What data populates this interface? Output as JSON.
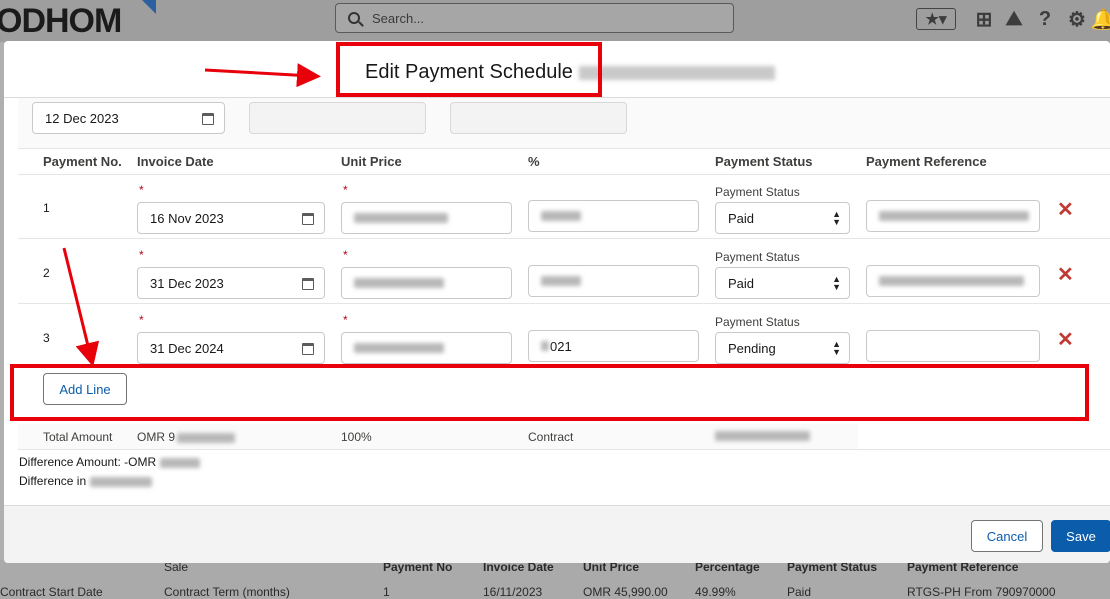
{
  "app": {
    "logo_text": "ODHOM",
    "search_placeholder": "Search..."
  },
  "modal": {
    "title": "Edit Payment Schedule",
    "top_date": "12 Dec 2023",
    "columns": [
      "Payment No.",
      "Invoice Date",
      "Unit Price",
      "%",
      "Payment Status",
      "Payment Reference"
    ],
    "required_mark": "*",
    "status_label": "Payment Status",
    "rows": [
      {
        "no": "1",
        "invoice_date": "16 Nov 2023",
        "status": "Paid",
        "percent": ""
      },
      {
        "no": "2",
        "invoice_date": "31 Dec 2023",
        "status": "Paid",
        "percent": ""
      },
      {
        "no": "3",
        "invoice_date": "31 Dec 2024",
        "status": "Pending",
        "percent": "021"
      }
    ],
    "add_line_label": "Add Line",
    "totals": {
      "label": "Total Amount",
      "amount_prefix": "OMR 9",
      "percent": "100%",
      "contract_label": "Contract"
    },
    "difference_amount_label": "Difference Amount: -OMR",
    "difference_in_label": "Difference in",
    "cancel_label": "Cancel",
    "save_label": "Save"
  },
  "background_table": {
    "left_labels": [
      "Contract Start Date",
      "Sale",
      "Contract Term (months)"
    ],
    "headers": [
      "Payment No",
      "Invoice Date",
      "Unit Price",
      "Percentage",
      "Payment Status",
      "Payment Reference"
    ],
    "row": [
      "1",
      "16/11/2023",
      "OMR 45,990.00",
      "49.99%",
      "Paid",
      "RTGS-PH From 790970000"
    ]
  },
  "colors": {
    "brand": "#0b5cab",
    "annotation_red": "#e8000b",
    "delete_red": "#c23934",
    "required_red": "#ba0517"
  },
  "icons": [
    "search-icon",
    "star-icon",
    "plus-icon",
    "trailhead-icon",
    "help-icon",
    "gear-icon",
    "calendar-icon",
    "close-icon",
    "select-arrows-icon"
  ]
}
